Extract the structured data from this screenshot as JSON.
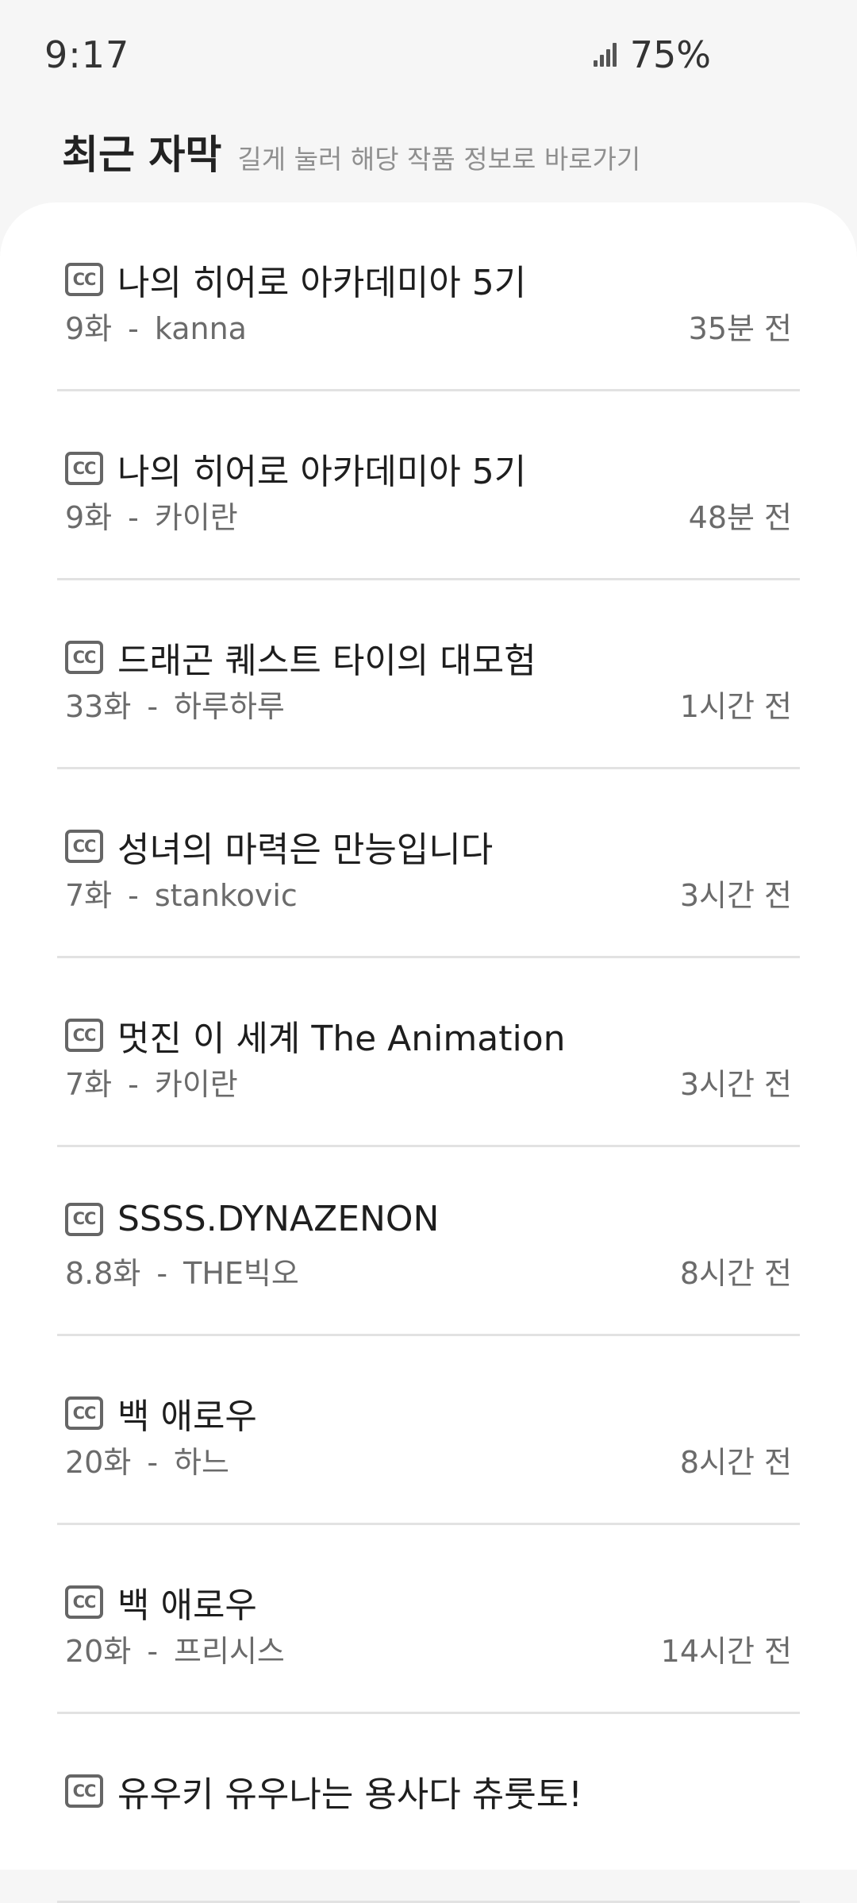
{
  "status_bar": {
    "time": "9:17",
    "battery": "75%",
    "signal_icon": "signal-icon"
  },
  "header": {
    "title": "최근 자막",
    "hint": "길게 눌러 해당 작품 정보로 바로가기"
  },
  "items": [
    {
      "icon": "cc-icon",
      "title": "나의 히어로 아카데미아 5기",
      "episode": "9화",
      "separator": "-",
      "author": "kanna",
      "time": "35분 전"
    },
    {
      "icon": "cc-icon",
      "title": "나의 히어로 아카데미아 5기",
      "episode": "9화",
      "separator": "-",
      "author": "카이란",
      "time": "48분 전"
    },
    {
      "icon": "cc-icon",
      "title": "드래곤 퀘스트 타이의 대모험",
      "episode": "33화",
      "separator": "-",
      "author": "하루하루",
      "time": "1시간 전"
    },
    {
      "icon": "cc-icon",
      "title": "성녀의 마력은 만능입니다",
      "episode": "7화",
      "separator": "-",
      "author": "stankovic",
      "time": "3시간 전"
    },
    {
      "icon": "cc-icon",
      "title": "멋진 이 세계 The Animation",
      "episode": "7화",
      "separator": "-",
      "author": "카이란",
      "time": "3시간 전"
    },
    {
      "icon": "cc-icon",
      "title": "SSSS.DYNAZENON",
      "episode": "8.8화",
      "separator": "-",
      "author": "THE빅오",
      "time": "8시간 전"
    },
    {
      "icon": "cc-icon",
      "title": "백 애로우",
      "episode": "20화",
      "separator": "-",
      "author": "하느",
      "time": "8시간 전"
    },
    {
      "icon": "cc-icon",
      "title": "백 애로우",
      "episode": "20화",
      "separator": "-",
      "author": "프리시스",
      "time": "14시간 전"
    },
    {
      "icon": "cc-icon",
      "title": "유우키 유우나는 용사다 츄룻토!",
      "episode": "",
      "separator": "",
      "author": "",
      "time": ""
    }
  ],
  "cc_label": "CC"
}
